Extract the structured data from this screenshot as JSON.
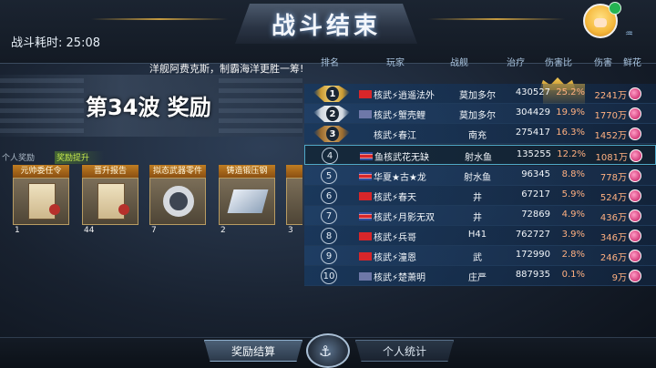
{
  "header": {
    "title": "战斗结束",
    "battle_time_label": "战斗耗时:",
    "battle_time_value": "25:08",
    "icons": [
      "avatar",
      "wifi-icon",
      "flip-flop-icon"
    ]
  },
  "announcement": "洋舰阿费克斯，制霸海洋更胜一筹!",
  "wave": {
    "text": "第34波 奖励"
  },
  "reward_tabs": {
    "personal": "个人奖励",
    "boost": "奖励提升"
  },
  "rewards": [
    {
      "label": "元帅委任令",
      "count": "1",
      "icon": "commission-document-icon"
    },
    {
      "label": "晋升报告",
      "count": "44",
      "icon": "promotion-report-icon"
    },
    {
      "label": "拟态武器零件",
      "count": "7",
      "icon": "weapon-part-icon"
    },
    {
      "label": "铸造锻压钢",
      "count": "2",
      "icon": "forged-steel-icon"
    },
    {
      "label": "",
      "count": "3",
      "icon": "partial-item-icon"
    }
  ],
  "leaderboard": {
    "headers": {
      "rank": "排名",
      "player": "玩家",
      "ship": "战舰",
      "heal": "治疗",
      "ratio": "伤害比",
      "damage": "伤害",
      "flower": "鲜花"
    },
    "rows": [
      {
        "rank": "1",
        "flag": "cn",
        "player": "核武⚡逍遥法外",
        "ship": "莫加多尔",
        "heal": "430527",
        "ratio": "25.2%",
        "damage": "2241万"
      },
      {
        "rank": "2",
        "flag": "un",
        "player": "核武⚡蟹壳鲤",
        "ship": "莫加多尔",
        "heal": "304429",
        "ratio": "19.9%",
        "damage": "1770万"
      },
      {
        "rank": "3",
        "flag": "none",
        "player": "核武⚡春江",
        "ship": "南充",
        "heal": "275417",
        "ratio": "16.3%",
        "damage": "1452万"
      },
      {
        "rank": "4",
        "flag": "kp",
        "player": "鱼核武花无缺",
        "ship": "射水鱼",
        "heal": "135255",
        "ratio": "12.2%",
        "damage": "1081万"
      },
      {
        "rank": "5",
        "flag": "kp",
        "player": "华夏★古★龙",
        "ship": "射水鱼",
        "heal": "96345",
        "ratio": "8.8%",
        "damage": "778万"
      },
      {
        "rank": "6",
        "flag": "cn",
        "player": "核武⚡春天",
        "ship": "井",
        "heal": "67217",
        "ratio": "5.9%",
        "damage": "524万"
      },
      {
        "rank": "7",
        "flag": "kp",
        "player": "核武⚡月影无双",
        "ship": "井",
        "heal": "72869",
        "ratio": "4.9%",
        "damage": "436万"
      },
      {
        "rank": "8",
        "flag": "cn",
        "player": "核武⚡兵哥",
        "ship": "H41",
        "heal": "762727",
        "ratio": "3.9%",
        "damage": "346万"
      },
      {
        "rank": "9",
        "flag": "cn",
        "player": "核武⚡潼恩",
        "ship": "武",
        "heal": "172990",
        "ratio": "2.8%",
        "damage": "246万"
      },
      {
        "rank": "10",
        "flag": "un",
        "player": "核武⚡楚萧明",
        "ship": "庄严",
        "heal": "887935",
        "ratio": "0.1%",
        "damage": "9万"
      }
    ]
  },
  "bottom": {
    "reward_button": "奖励结算",
    "stats_button": "个人统计"
  }
}
